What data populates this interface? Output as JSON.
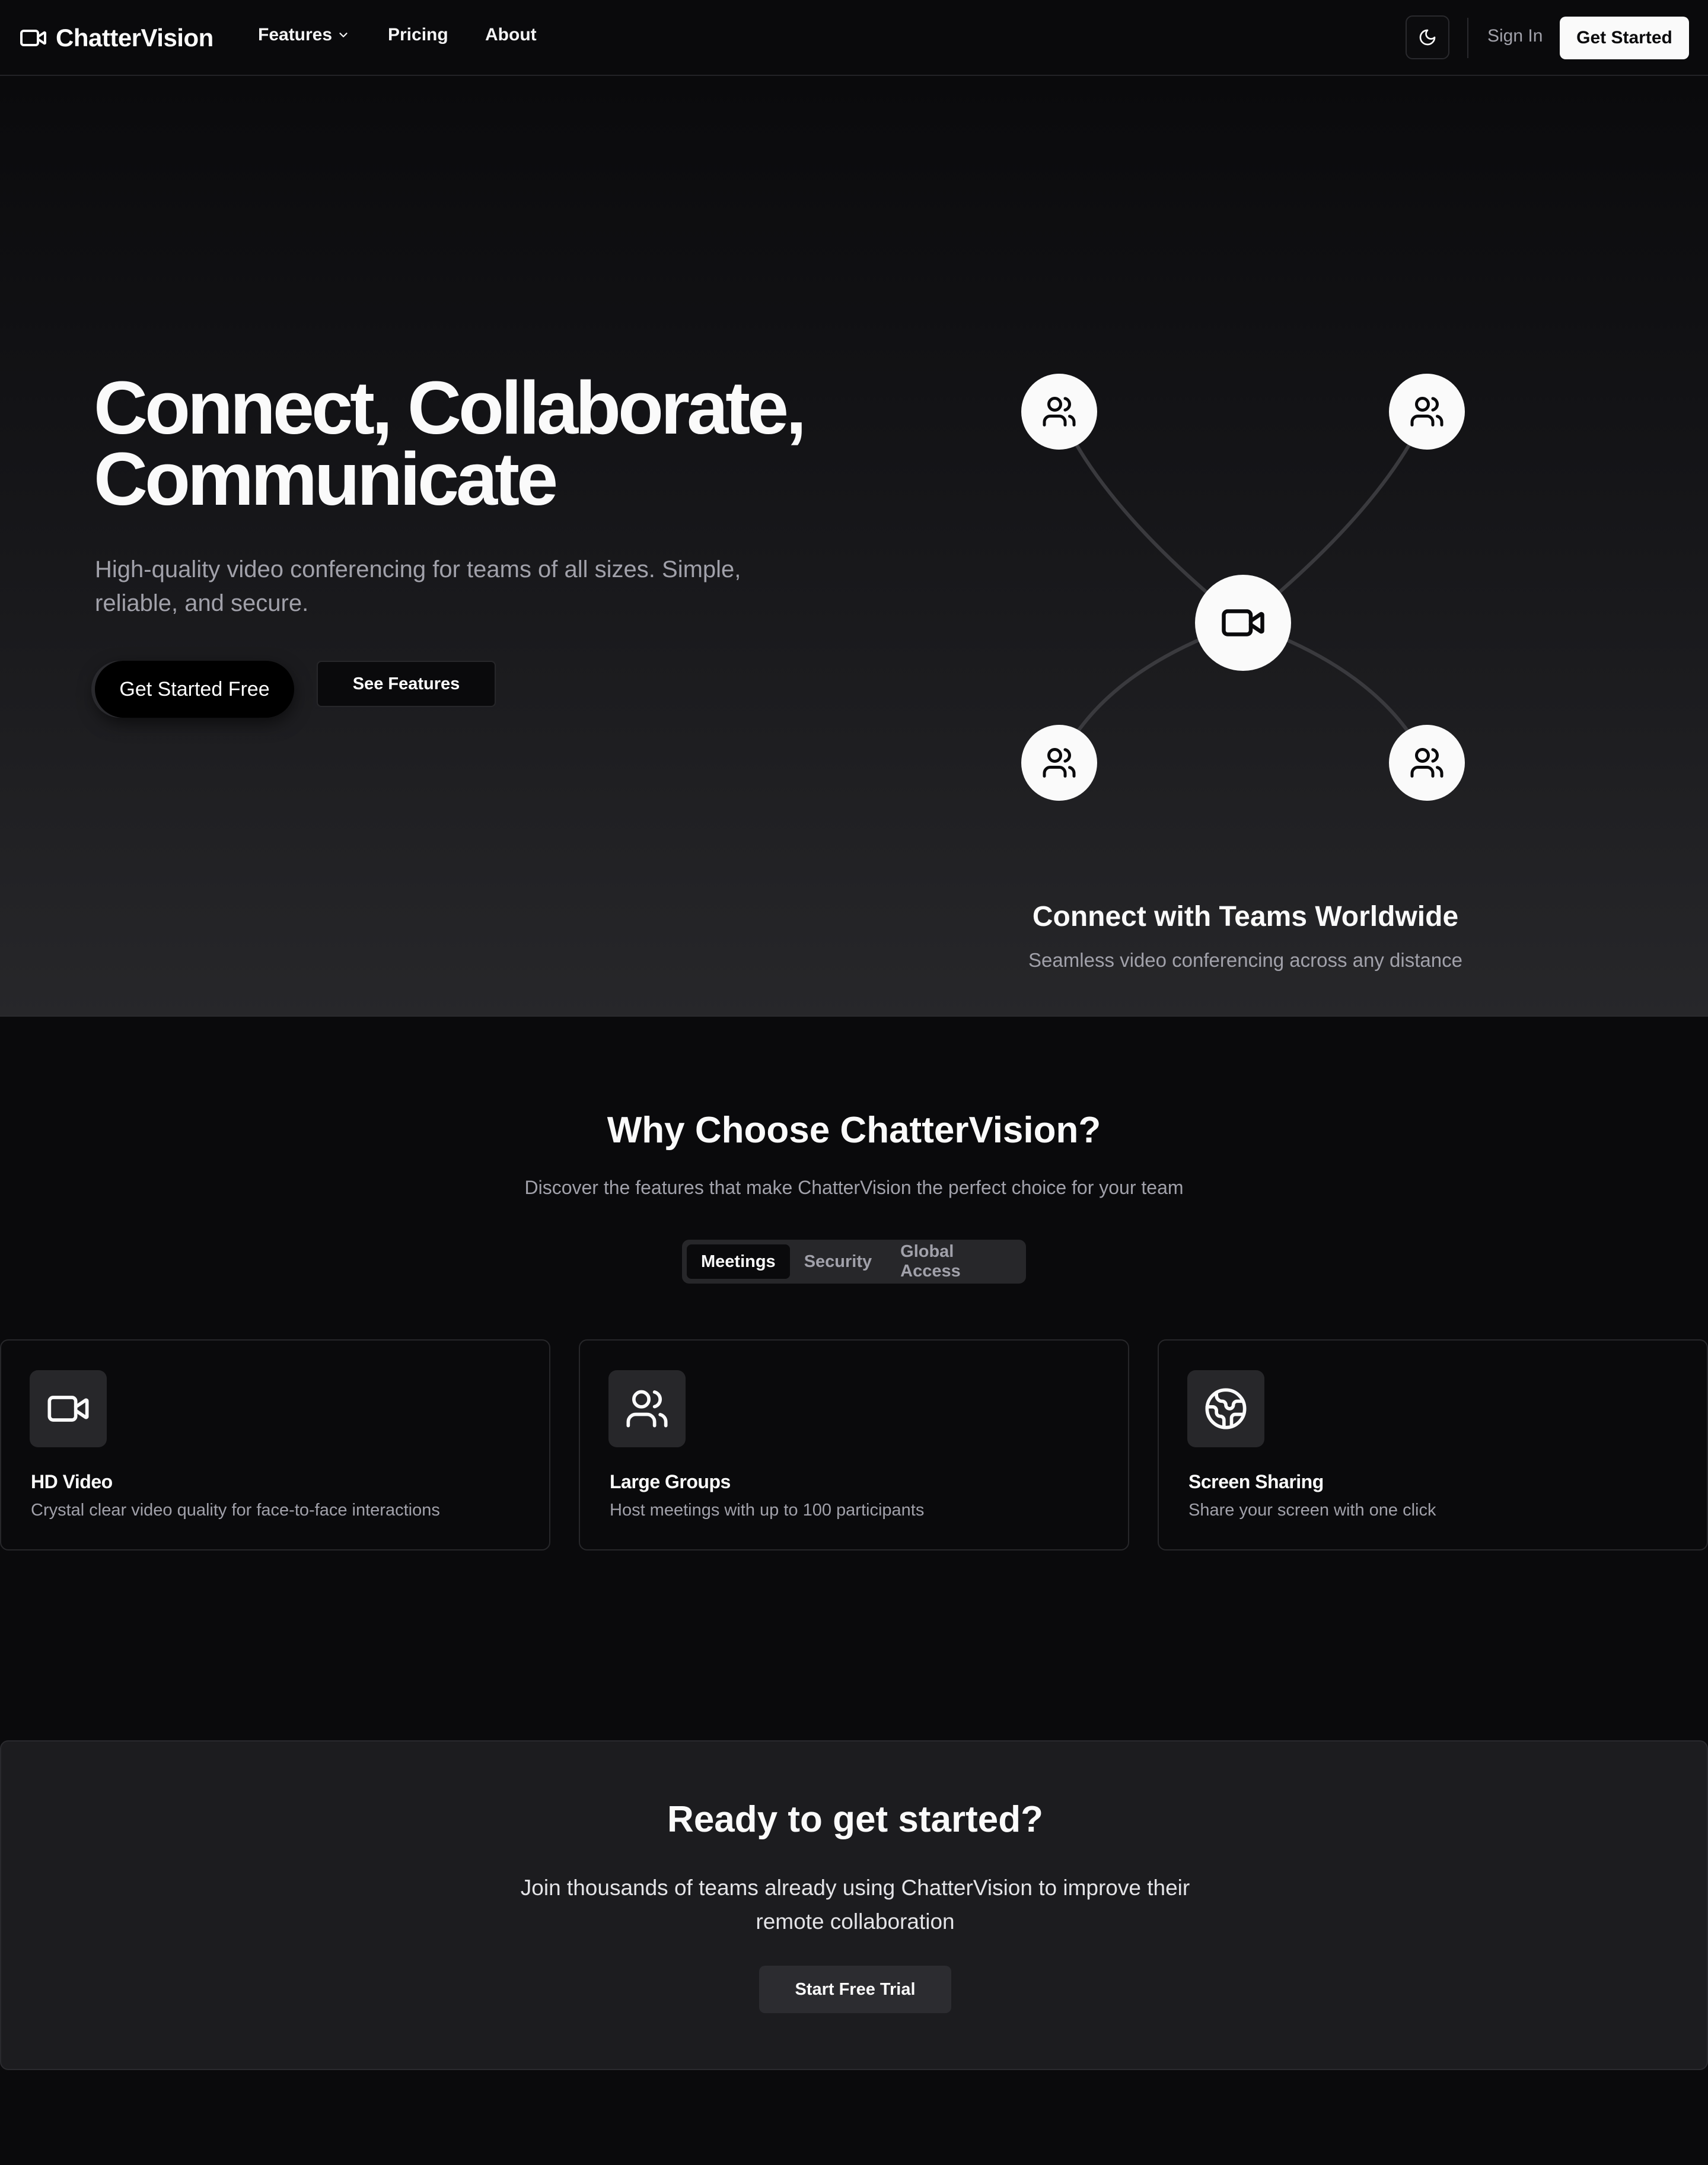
{
  "nav": {
    "brand": "ChatterVision",
    "brand_icon": "video-camera-icon",
    "links": [
      {
        "label": "Features",
        "has_dropdown": true
      },
      {
        "label": "Pricing"
      },
      {
        "label": "About"
      }
    ],
    "theme_toggle_icon": "moon-icon",
    "sign_in": "Sign In",
    "get_started": "Get Started"
  },
  "hero": {
    "title": "Connect, Collaborate, Communicate",
    "subtitle": "High-quality video conferencing for teams of all sizes. Simple, reliable, and secure.",
    "primary_cta": "Get Started Free",
    "secondary_cta": "See Features",
    "network": {
      "center_icon": "video-camera-icon",
      "node_icon": "users-icon",
      "title": "Connect with Teams Worldwide",
      "subtitle": "Seamless video conferencing across any distance"
    }
  },
  "features": {
    "title": "Why Choose ChatterVision?",
    "subtitle": "Discover the features that make ChatterVision the perfect choice for your team",
    "tabs": [
      {
        "label": "Meetings",
        "active": true
      },
      {
        "label": "Security",
        "active": false
      },
      {
        "label": "Global Access",
        "active": false
      }
    ],
    "cards": [
      {
        "icon": "video-camera-icon",
        "title": "HD Video",
        "description": "Crystal clear video quality for face-to-face interactions"
      },
      {
        "icon": "users-icon",
        "title": "Large Groups",
        "description": "Host meetings with up to 100 participants"
      },
      {
        "icon": "globe-icon",
        "title": "Screen Sharing",
        "description": "Share your screen with one click"
      }
    ]
  },
  "cta": {
    "title": "Ready to get started?",
    "subtitle": "Join thousands of teams already using ChatterVision to improve their remote collaboration",
    "button": "Start Free Trial"
  },
  "colors": {
    "background": "#0a0a0c",
    "surface": "#27272a",
    "text": "#fafafa",
    "muted": "#a1a1aa"
  }
}
